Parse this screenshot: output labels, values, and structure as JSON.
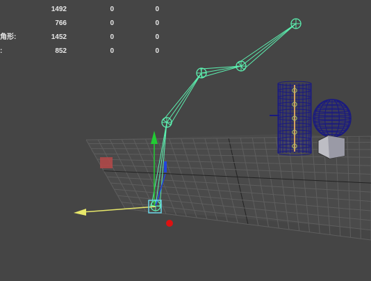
{
  "hud": {
    "rows": [
      {
        "label": "",
        "v1": "1492",
        "v2": "0",
        "v3": "0"
      },
      {
        "label": "",
        "v1": "766",
        "v2": "0",
        "v3": "0"
      },
      {
        "label": "角形:",
        "v1": "1452",
        "v2": "0",
        "v3": "0"
      },
      {
        "label": ":",
        "v1": "852",
        "v2": "0",
        "v3": "0"
      }
    ]
  },
  "colors": {
    "viewport_bg": "#454545",
    "grid": "#5a5a5a",
    "grid_dark": "#333333",
    "joint": "#5cf0b0",
    "mesh": "#1a1a80",
    "x_axis": "#e8e86a",
    "y_axis": "#22cc33",
    "z_axis": "#2244dd",
    "selected": "#6ad6e8"
  },
  "icons": [
    "move-manipulator-icon",
    "joint-icon",
    "cylinder-mesh-icon",
    "sphere-mesh-icon",
    "cube-mesh-icon",
    "locator-icon"
  ]
}
